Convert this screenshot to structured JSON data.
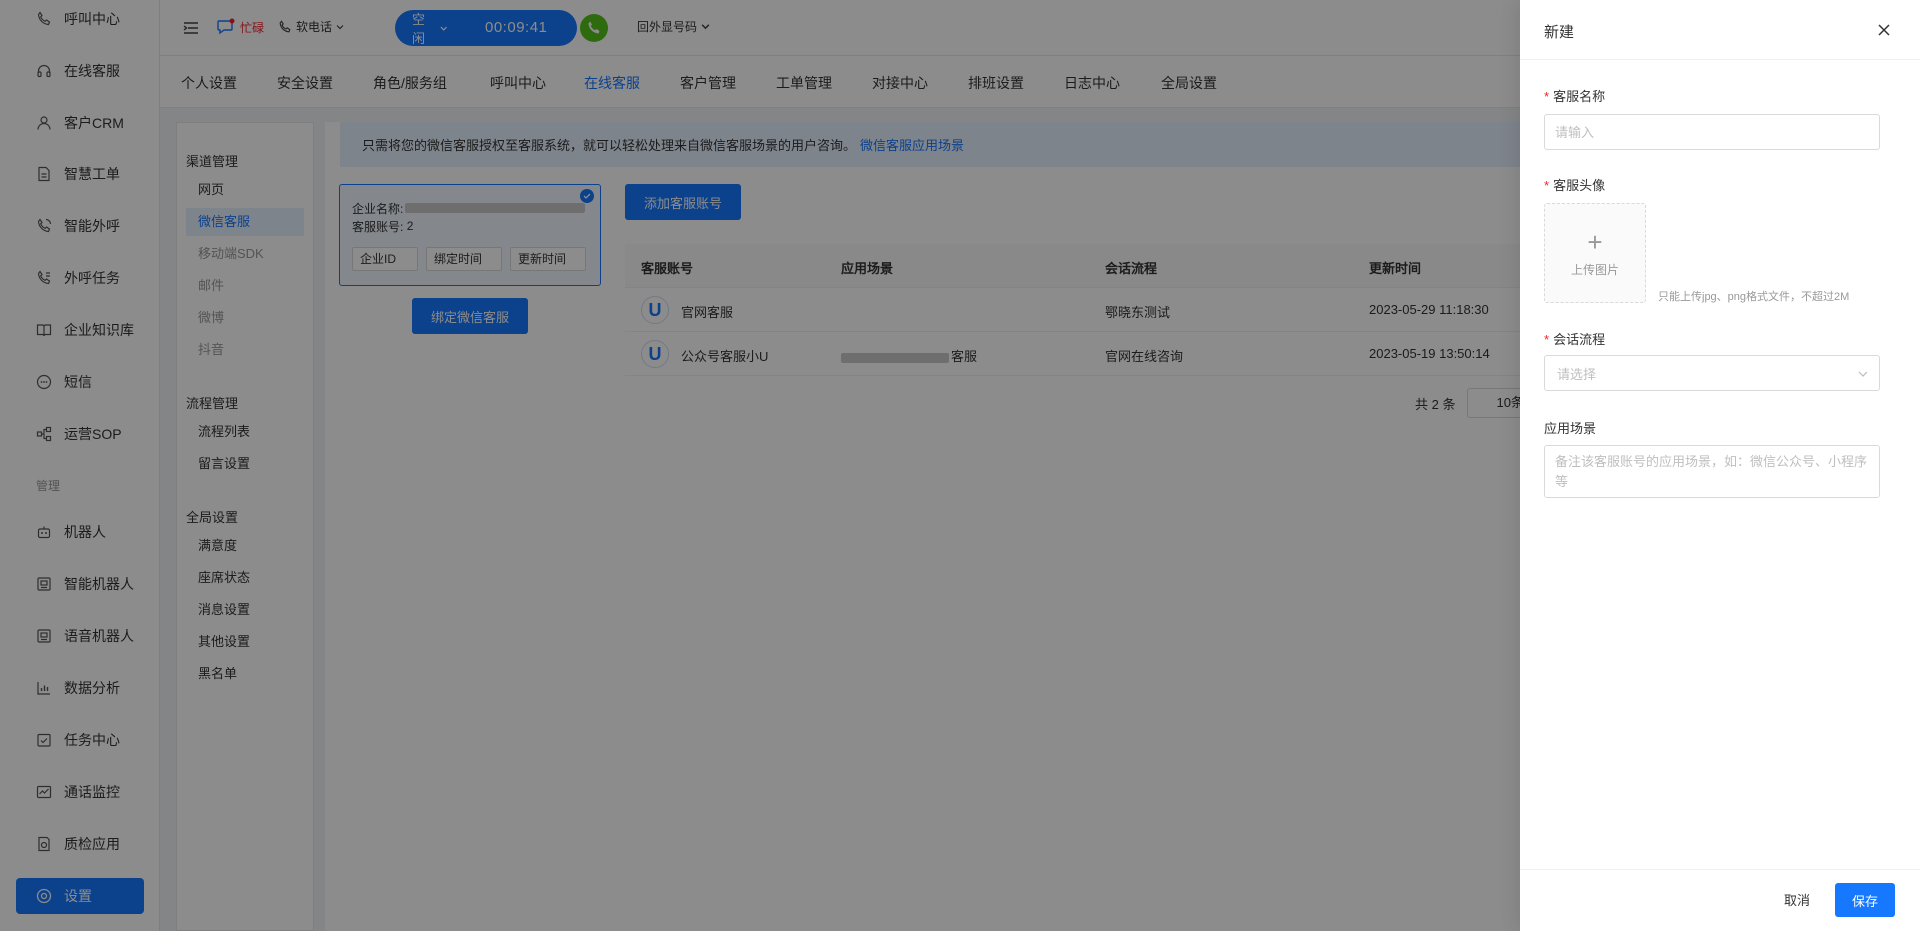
{
  "colors": {
    "primary": "#1677ff",
    "call_green": "#52c41a",
    "required": "#f5222d",
    "brand_red": "#f5222d"
  },
  "sidebar": {
    "items": [
      {
        "label": "呼叫中心",
        "icon": "phone-icon"
      },
      {
        "label": "在线客服",
        "icon": "headset-icon"
      },
      {
        "label": "客户CRM",
        "icon": "user-icon"
      },
      {
        "label": "智慧工单",
        "icon": "document-icon"
      },
      {
        "label": "智能外呼",
        "icon": "phone-call-icon"
      },
      {
        "label": "外呼任务",
        "icon": "phone-task-icon"
      },
      {
        "label": "企业知识库",
        "icon": "book-icon"
      },
      {
        "label": "短信",
        "icon": "sms-icon"
      },
      {
        "label": "运营SOP",
        "icon": "flow-icon"
      }
    ],
    "group_label": "管理",
    "manage_items": [
      {
        "label": "机器人",
        "icon": "robot-icon"
      },
      {
        "label": "智能机器人",
        "icon": "smart-robot-icon"
      },
      {
        "label": "语音机器人",
        "icon": "voice-robot-icon"
      },
      {
        "label": "数据分析",
        "icon": "chart-icon"
      },
      {
        "label": "任务中心",
        "icon": "task-icon"
      },
      {
        "label": "通话监控",
        "icon": "monitor-icon"
      },
      {
        "label": "质检应用",
        "icon": "inspect-icon"
      }
    ],
    "active_item": {
      "label": "设置",
      "icon": "gear-icon"
    }
  },
  "topbar": {
    "brand": "忙碌",
    "softphone": "软电话",
    "status": "空闲",
    "timer": "00:09:41",
    "outbound": "回外显号码"
  },
  "tabs": [
    "个人设置",
    "安全设置",
    "角色/服务组",
    "呼叫中心",
    "在线客服",
    "客户管理",
    "工单管理",
    "对接中心",
    "排班设置",
    "日志中心",
    "全局设置"
  ],
  "active_tab": "在线客服",
  "subnav": {
    "group1": "渠道管理",
    "group1_items": [
      "网页",
      "微信客服",
      "移动端SDK",
      "邮件",
      "微博",
      "抖音"
    ],
    "group2": "流程管理",
    "group2_items": [
      "流程列表",
      "留言设置"
    ],
    "group3": "全局设置",
    "group3_items": [
      "满意度",
      "座席状态",
      "消息设置",
      "其他设置",
      "黑名单"
    ]
  },
  "main": {
    "notice_text": "只需将您的微信客服授权至客服系统，就可以轻松处理来自微信客服场景的用户咨询。",
    "notice_link": "微信客服应用场景",
    "card": {
      "company_label": "企业名称:",
      "account_label": "客服账号:",
      "account_value": "2",
      "chips": [
        "企业ID",
        "绑定时间",
        "更新时间"
      ]
    },
    "bind_button": "绑定微信客服",
    "add_button": "添加客服账号",
    "table": {
      "headers": [
        "客服账号",
        "应用场景",
        "会话流程",
        "更新时间"
      ],
      "rows": [
        {
          "account": "官网客服",
          "scene": "",
          "flow": "鄂晓东测试",
          "updated": "2023-05-29 11:18:30"
        },
        {
          "account": "公众号客服小U",
          "scene": "客服",
          "flow": "官网在线咨询",
          "updated": "2023-05-19 13:50:14"
        }
      ]
    },
    "pager_total": "共 2 条",
    "pager_size": "10条"
  },
  "drawer": {
    "title": "新建",
    "name_label": "客服名称",
    "name_placeholder": "请输入",
    "avatar_label": "客服头像",
    "upload_text": "上传图片",
    "upload_hint": "只能上传jpg、png格式文件，不超过2M",
    "flow_label": "会话流程",
    "flow_placeholder": "请选择",
    "scene_label": "应用场景",
    "scene_placeholder": "备注该客服账号的应用场景，如：微信公众号、小程序等",
    "cancel": "取消",
    "save": "保存"
  }
}
